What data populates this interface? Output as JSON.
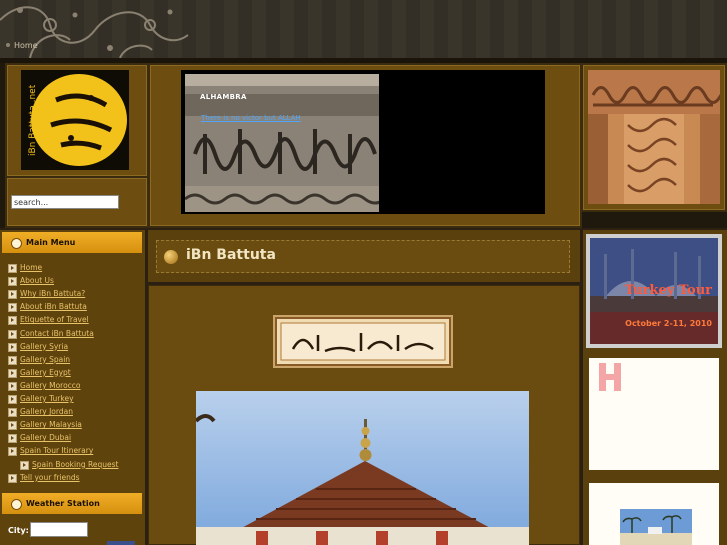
{
  "topbar": {
    "home_link": "Home"
  },
  "logo": {
    "text": "iBn Battuta .net",
    "arabic": "ابن بطوطة"
  },
  "search": {
    "value": "search..."
  },
  "slideshow": {
    "caption": "ALHAMBRA",
    "link": "There is no victor but ALLAH"
  },
  "sidebar": {
    "main_menu_title": "Main Menu",
    "items": [
      {
        "label": "Home",
        "sub": false
      },
      {
        "label": "About Us",
        "sub": false
      },
      {
        "label": "Why iBn Battuta?",
        "sub": false
      },
      {
        "label": "About iBn Battuta",
        "sub": false
      },
      {
        "label": "Etiquette of Travel",
        "sub": false
      },
      {
        "label": "Contact iBn Battuta",
        "sub": false
      },
      {
        "label": "Gallery Syria",
        "sub": false
      },
      {
        "label": "Gallery Spain",
        "sub": false
      },
      {
        "label": "Gallery Egypt",
        "sub": false
      },
      {
        "label": "Gallery Morocco",
        "sub": false
      },
      {
        "label": "Gallery Turkey",
        "sub": false
      },
      {
        "label": "Gallery Jordan",
        "sub": false
      },
      {
        "label": "Gallery Malaysia",
        "sub": false
      },
      {
        "label": "Gallery Dubai",
        "sub": false
      },
      {
        "label": "Spain Tour Itinerary",
        "sub": false
      },
      {
        "label": "Spain Booking Request",
        "sub": true
      },
      {
        "label": "Tell your friends",
        "sub": false
      }
    ],
    "weather_title": "Weather Station",
    "city_label": "City:",
    "city_value": ""
  },
  "main": {
    "page_title": "iBn Battuta",
    "bismillah": "بسم الله الرحمن الرحيم"
  },
  "right": {
    "turkey_title": "Turkey Tour",
    "turkey_dates": "October 2-11, 2010"
  },
  "colors": {
    "accent": "#f0ad26",
    "link": "#e8c36a",
    "panel": "#6e4e10"
  }
}
